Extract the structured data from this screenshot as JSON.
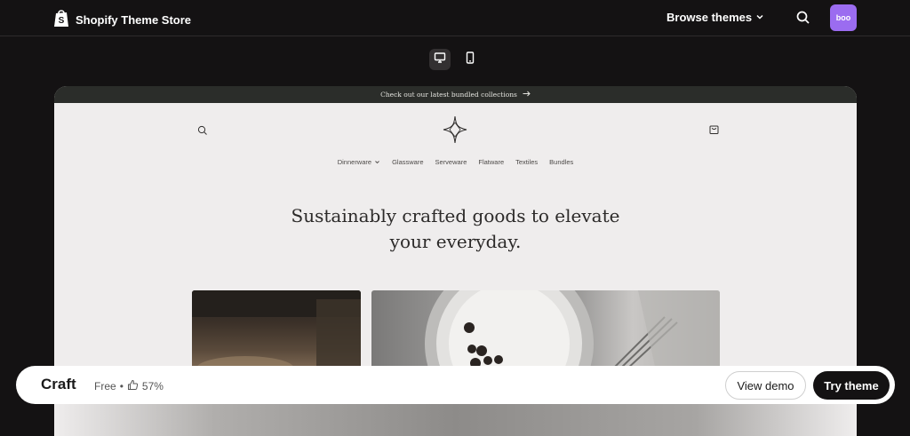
{
  "header": {
    "brand": "Shopify Theme Store",
    "browse_label": "Browse themes",
    "avatar_initials": "boo"
  },
  "device_toggle": {
    "active": "desktop"
  },
  "preview": {
    "announcement": "Check out our latest bundled collections",
    "nav_items": [
      "Dinnerware",
      "Glassware",
      "Serveware",
      "Flatware",
      "Textiles",
      "Bundles"
    ],
    "hero_line1": "Sustainably crafted goods to elevate",
    "hero_line2": "your everyday."
  },
  "theme_bar": {
    "name": "Craft",
    "price": "Free",
    "separator": "•",
    "rating": "57%",
    "view_demo_label": "View demo",
    "try_theme_label": "Try theme"
  },
  "colors": {
    "page_bg": "#141213",
    "avatar_bg": "#9b6cf0",
    "announcement_bg": "#2b2d2a",
    "store_bg": "#efeded"
  }
}
